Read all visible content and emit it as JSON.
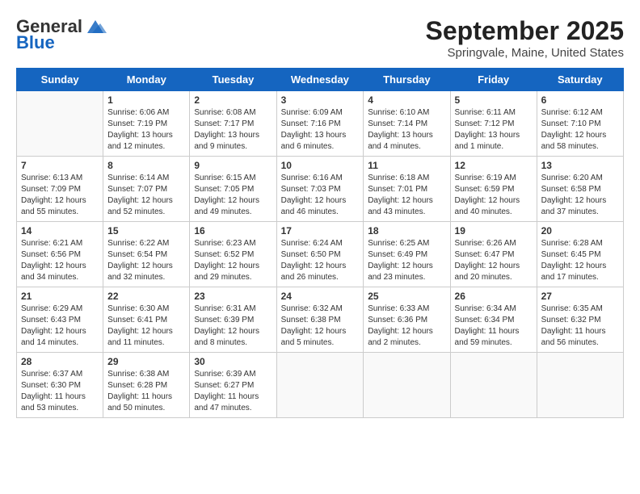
{
  "header": {
    "logo_general": "General",
    "logo_blue": "Blue",
    "month": "September 2025",
    "location": "Springvale, Maine, United States"
  },
  "days_of_week": [
    "Sunday",
    "Monday",
    "Tuesday",
    "Wednesday",
    "Thursday",
    "Friday",
    "Saturday"
  ],
  "weeks": [
    [
      {
        "day": "",
        "sunrise": "",
        "sunset": "",
        "daylight": ""
      },
      {
        "day": "1",
        "sunrise": "Sunrise: 6:06 AM",
        "sunset": "Sunset: 7:19 PM",
        "daylight": "Daylight: 13 hours and 12 minutes."
      },
      {
        "day": "2",
        "sunrise": "Sunrise: 6:08 AM",
        "sunset": "Sunset: 7:17 PM",
        "daylight": "Daylight: 13 hours and 9 minutes."
      },
      {
        "day": "3",
        "sunrise": "Sunrise: 6:09 AM",
        "sunset": "Sunset: 7:16 PM",
        "daylight": "Daylight: 13 hours and 6 minutes."
      },
      {
        "day": "4",
        "sunrise": "Sunrise: 6:10 AM",
        "sunset": "Sunset: 7:14 PM",
        "daylight": "Daylight: 13 hours and 4 minutes."
      },
      {
        "day": "5",
        "sunrise": "Sunrise: 6:11 AM",
        "sunset": "Sunset: 7:12 PM",
        "daylight": "Daylight: 13 hours and 1 minute."
      },
      {
        "day": "6",
        "sunrise": "Sunrise: 6:12 AM",
        "sunset": "Sunset: 7:10 PM",
        "daylight": "Daylight: 12 hours and 58 minutes."
      }
    ],
    [
      {
        "day": "7",
        "sunrise": "Sunrise: 6:13 AM",
        "sunset": "Sunset: 7:09 PM",
        "daylight": "Daylight: 12 hours and 55 minutes."
      },
      {
        "day": "8",
        "sunrise": "Sunrise: 6:14 AM",
        "sunset": "Sunset: 7:07 PM",
        "daylight": "Daylight: 12 hours and 52 minutes."
      },
      {
        "day": "9",
        "sunrise": "Sunrise: 6:15 AM",
        "sunset": "Sunset: 7:05 PM",
        "daylight": "Daylight: 12 hours and 49 minutes."
      },
      {
        "day": "10",
        "sunrise": "Sunrise: 6:16 AM",
        "sunset": "Sunset: 7:03 PM",
        "daylight": "Daylight: 12 hours and 46 minutes."
      },
      {
        "day": "11",
        "sunrise": "Sunrise: 6:18 AM",
        "sunset": "Sunset: 7:01 PM",
        "daylight": "Daylight: 12 hours and 43 minutes."
      },
      {
        "day": "12",
        "sunrise": "Sunrise: 6:19 AM",
        "sunset": "Sunset: 6:59 PM",
        "daylight": "Daylight: 12 hours and 40 minutes."
      },
      {
        "day": "13",
        "sunrise": "Sunrise: 6:20 AM",
        "sunset": "Sunset: 6:58 PM",
        "daylight": "Daylight: 12 hours and 37 minutes."
      }
    ],
    [
      {
        "day": "14",
        "sunrise": "Sunrise: 6:21 AM",
        "sunset": "Sunset: 6:56 PM",
        "daylight": "Daylight: 12 hours and 34 minutes."
      },
      {
        "day": "15",
        "sunrise": "Sunrise: 6:22 AM",
        "sunset": "Sunset: 6:54 PM",
        "daylight": "Daylight: 12 hours and 32 minutes."
      },
      {
        "day": "16",
        "sunrise": "Sunrise: 6:23 AM",
        "sunset": "Sunset: 6:52 PM",
        "daylight": "Daylight: 12 hours and 29 minutes."
      },
      {
        "day": "17",
        "sunrise": "Sunrise: 6:24 AM",
        "sunset": "Sunset: 6:50 PM",
        "daylight": "Daylight: 12 hours and 26 minutes."
      },
      {
        "day": "18",
        "sunrise": "Sunrise: 6:25 AM",
        "sunset": "Sunset: 6:49 PM",
        "daylight": "Daylight: 12 hours and 23 minutes."
      },
      {
        "day": "19",
        "sunrise": "Sunrise: 6:26 AM",
        "sunset": "Sunset: 6:47 PM",
        "daylight": "Daylight: 12 hours and 20 minutes."
      },
      {
        "day": "20",
        "sunrise": "Sunrise: 6:28 AM",
        "sunset": "Sunset: 6:45 PM",
        "daylight": "Daylight: 12 hours and 17 minutes."
      }
    ],
    [
      {
        "day": "21",
        "sunrise": "Sunrise: 6:29 AM",
        "sunset": "Sunset: 6:43 PM",
        "daylight": "Daylight: 12 hours and 14 minutes."
      },
      {
        "day": "22",
        "sunrise": "Sunrise: 6:30 AM",
        "sunset": "Sunset: 6:41 PM",
        "daylight": "Daylight: 12 hours and 11 minutes."
      },
      {
        "day": "23",
        "sunrise": "Sunrise: 6:31 AM",
        "sunset": "Sunset: 6:39 PM",
        "daylight": "Daylight: 12 hours and 8 minutes."
      },
      {
        "day": "24",
        "sunrise": "Sunrise: 6:32 AM",
        "sunset": "Sunset: 6:38 PM",
        "daylight": "Daylight: 12 hours and 5 minutes."
      },
      {
        "day": "25",
        "sunrise": "Sunrise: 6:33 AM",
        "sunset": "Sunset: 6:36 PM",
        "daylight": "Daylight: 12 hours and 2 minutes."
      },
      {
        "day": "26",
        "sunrise": "Sunrise: 6:34 AM",
        "sunset": "Sunset: 6:34 PM",
        "daylight": "Daylight: 11 hours and 59 minutes."
      },
      {
        "day": "27",
        "sunrise": "Sunrise: 6:35 AM",
        "sunset": "Sunset: 6:32 PM",
        "daylight": "Daylight: 11 hours and 56 minutes."
      }
    ],
    [
      {
        "day": "28",
        "sunrise": "Sunrise: 6:37 AM",
        "sunset": "Sunset: 6:30 PM",
        "daylight": "Daylight: 11 hours and 53 minutes."
      },
      {
        "day": "29",
        "sunrise": "Sunrise: 6:38 AM",
        "sunset": "Sunset: 6:28 PM",
        "daylight": "Daylight: 11 hours and 50 minutes."
      },
      {
        "day": "30",
        "sunrise": "Sunrise: 6:39 AM",
        "sunset": "Sunset: 6:27 PM",
        "daylight": "Daylight: 11 hours and 47 minutes."
      },
      {
        "day": "",
        "sunrise": "",
        "sunset": "",
        "daylight": ""
      },
      {
        "day": "",
        "sunrise": "",
        "sunset": "",
        "daylight": ""
      },
      {
        "day": "",
        "sunrise": "",
        "sunset": "",
        "daylight": ""
      },
      {
        "day": "",
        "sunrise": "",
        "sunset": "",
        "daylight": ""
      }
    ]
  ]
}
